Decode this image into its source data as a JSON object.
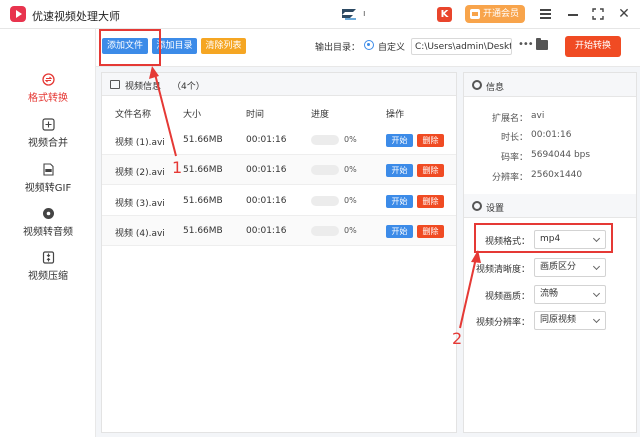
{
  "app": {
    "title": "优速视频处理大师",
    "center_dot": "ı"
  },
  "header": {
    "vip_label": "开通会员"
  },
  "sidebar": {
    "items": [
      {
        "label": "格式转换",
        "active": true
      },
      {
        "label": "视频合并"
      },
      {
        "label": "视频转GIF"
      },
      {
        "label": "视频转音频"
      },
      {
        "label": "视频压缩"
      }
    ]
  },
  "toolbar": {
    "add_file": "添加文件",
    "add_dir": "添加目录",
    "clear": "清除列表",
    "output_label": "输出目录：",
    "output_option": "自定义",
    "output_path": "C:\\Users\\admin\\Deskto",
    "start_convert": "开始转换"
  },
  "files": {
    "title": "视频信息",
    "count": "（4个）",
    "columns": {
      "name": "文件名称",
      "size": "大小",
      "time": "时间",
      "progress": "进度",
      "action": "操作"
    },
    "rows": [
      {
        "name": "视频 (1).avi",
        "size": "51.66MB",
        "time": "00:01:16",
        "progress": "0%",
        "start": "开始",
        "delete": "删除"
      },
      {
        "name": "视频 (2).avi",
        "size": "51.66MB",
        "time": "00:01:16",
        "progress": "0%",
        "start": "开始",
        "delete": "删除"
      },
      {
        "name": "视频 (3).avi",
        "size": "51.66MB",
        "time": "00:01:16",
        "progress": "0%",
        "start": "开始",
        "delete": "删除"
      },
      {
        "name": "视频 (4).avi",
        "size": "51.66MB",
        "time": "00:01:16",
        "progress": "0%",
        "start": "开始",
        "delete": "删除"
      }
    ]
  },
  "info": {
    "title": "信息",
    "rows": [
      {
        "key": "扩展名：",
        "value": "avi"
      },
      {
        "key": "时长：",
        "value": "00:01:16"
      },
      {
        "key": "码率：",
        "value": "5694044 bps"
      },
      {
        "key": "分辨率：",
        "value": "2560x1440"
      }
    ]
  },
  "settings": {
    "title": "设置",
    "rows": [
      {
        "key": "视频格式：",
        "value": "mp4"
      },
      {
        "key": "视频清晰度：",
        "value": "画质区分"
      },
      {
        "key": "视频画质：",
        "value": "流畅"
      },
      {
        "key": "视频分辨率：",
        "value": "同原视频"
      }
    ]
  },
  "annotations": {
    "one": "1",
    "two": "2"
  },
  "colors": {
    "accent": "#e53935",
    "primary_blue": "#3c8be8",
    "start_orange": "#f04b23",
    "clear_yellow": "#f5a623"
  }
}
